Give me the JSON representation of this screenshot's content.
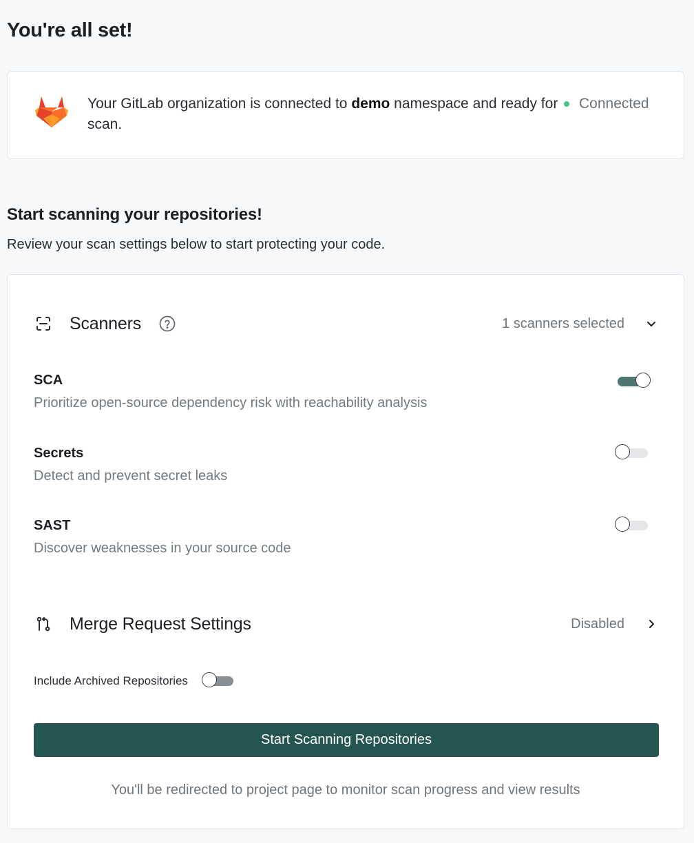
{
  "page": {
    "title": "You're all set!"
  },
  "connection": {
    "message_before": "Your GitLab organization is connected to ",
    "namespace": "demo",
    "message_after": " namespace and ready for scan.",
    "status_label": "Connected",
    "status_color": "#4cc38a",
    "logo_icon": "gitlab-logo"
  },
  "section": {
    "title": "Start scanning your repositories!",
    "subtitle": "Review your scan settings below to start protecting your code."
  },
  "scanners": {
    "icon": "scan-frame-icon",
    "title": "Scanners",
    "summary": "1 scanners selected",
    "items": [
      {
        "name": "SCA",
        "description": "Prioritize open-source dependency risk with reachability analysis",
        "enabled": true
      },
      {
        "name": "Secrets",
        "description": "Detect and prevent secret leaks",
        "enabled": false
      },
      {
        "name": "SAST",
        "description": "Discover weaknesses in your source code",
        "enabled": false
      }
    ]
  },
  "merge_request": {
    "icon": "git-merge-icon",
    "title": "Merge Request Settings",
    "status": "Disabled"
  },
  "archived": {
    "label": "Include Archived Repositories",
    "enabled": false
  },
  "cta": {
    "label": "Start Scanning Repositories",
    "color": "#245550"
  },
  "footnote": "You'll be redirected to project page to monitor scan progress and view results"
}
